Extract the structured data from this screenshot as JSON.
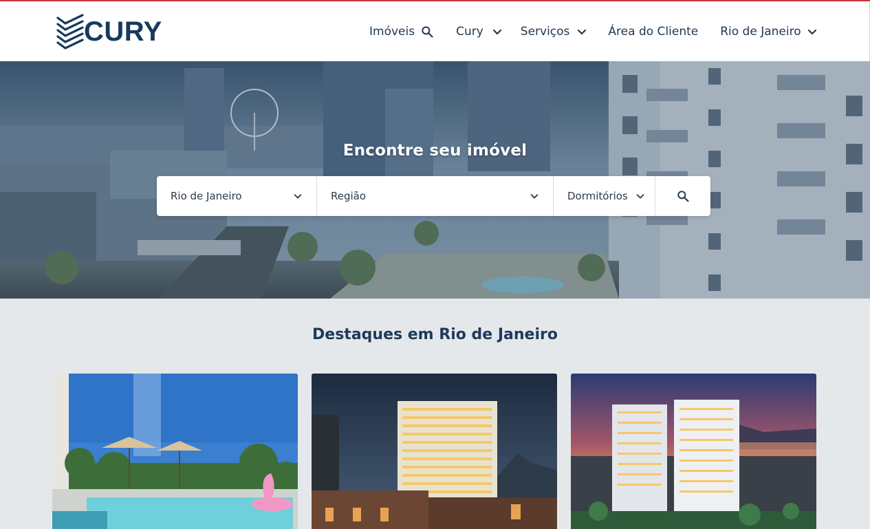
{
  "brand": {
    "name": "CURY",
    "color": "#17395c"
  },
  "nav": {
    "items": [
      {
        "label": "Imóveis",
        "icon": "search-icon"
      },
      {
        "label": "Cury",
        "icon": "chevron-down-icon"
      },
      {
        "label": "Serviços",
        "icon": "chevron-down-icon"
      },
      {
        "label": "Área do Cliente"
      },
      {
        "label": "Rio de Janeiro",
        "icon": "chevron-down-icon"
      }
    ]
  },
  "hero": {
    "title": "Encontre seu imóvel",
    "search": {
      "city": "Rio de Janeiro",
      "region_placeholder": "Região",
      "rooms_placeholder": "Dormitórios"
    }
  },
  "featured": {
    "title": "Destaques em Rio de Janeiro"
  },
  "colors": {
    "accent_line": "#c8323a",
    "text_dark": "#1e3a5a",
    "page_bg": "#e5e8eb"
  }
}
